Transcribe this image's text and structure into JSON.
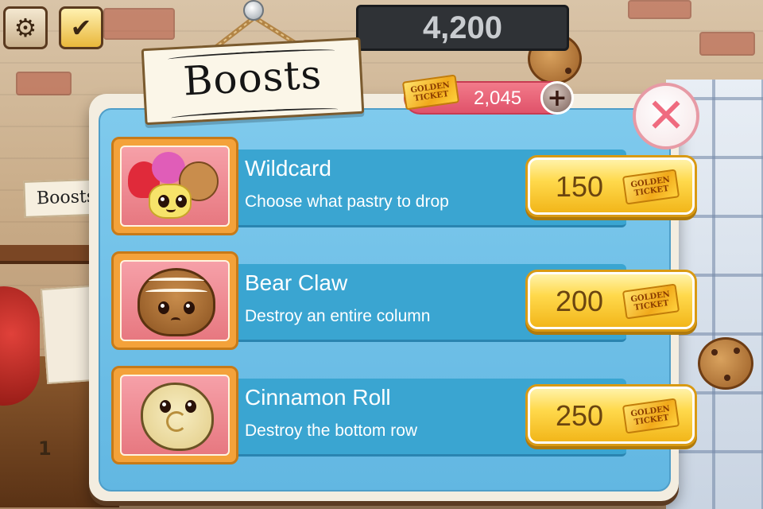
{
  "hud": {
    "settings_icon": "gear-icon",
    "confirm_icon": "checkmark-icon",
    "score": "4,200"
  },
  "background": {
    "sign_label": "Boosts",
    "level_number": "1"
  },
  "modal": {
    "title": "Boosts",
    "golden_tickets": {
      "label": "GOLDEN TICKET",
      "count": "2,045",
      "add_label": "+"
    },
    "close_label": "✕",
    "boosts": [
      {
        "name": "Wildcard",
        "description": "Choose what pastry to drop",
        "price": "150",
        "ticket_label": "GOLDEN TICKET",
        "icon": "assorted-pastries-icon"
      },
      {
        "name": "Bear Claw",
        "description": "Destroy an entire column",
        "price": "200",
        "ticket_label": "GOLDEN TICKET",
        "icon": "bear-claw-pastry-icon"
      },
      {
        "name": "Cinnamon Roll",
        "description": "Destroy the bottom row",
        "price": "250",
        "ticket_label": "GOLDEN TICKET",
        "icon": "cinnamon-roll-icon"
      }
    ]
  },
  "colors": {
    "modal_blue": "#62b7e2",
    "row_blue": "#3aa5d1",
    "price_gold": "#ffd94c",
    "close_pink": "#ef6b7f",
    "counter_pink": "#e0526a"
  }
}
